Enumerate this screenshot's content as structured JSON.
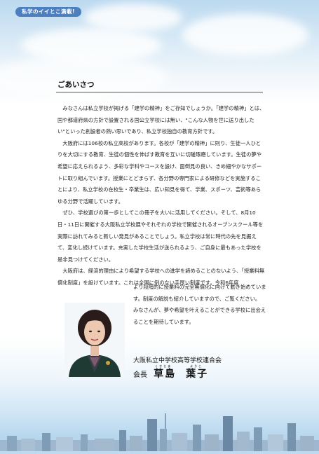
{
  "header": {
    "tag": "私学のイイとこ満載!"
  },
  "section": {
    "title": "ごあいさつ"
  },
  "paragraphs": [
    "みなさんは私立学校が掲げる「建学の精神」をご存知でしょうか。「建学の精神」とは、国や都道府県の方針で設置される国公立学校には無い、\"こんな人物を世に送り出したい\"といった創設者の熱い思いであり、私立学校独自の教育方針です。",
    "大阪府には106校の私立高校があります。各校が「建学の精神」に則り、生徒一人ひとりを大切にする教育、生徒の個性を伸ばす教育を互いに切磋琢磨しています。生徒の夢や希望に応えられるよう、多彩な学科やコースを設け、面倒見の良い、きめ細やかなサポートに取り組んでいます。授業にとどまらず、各分野の専門家による研修などを実施することにより、私立学校の在校生・卒業生は、広い知見を得て、学業、スポーツ、芸術等あらゆる分野で活躍しています。",
    "ぜひ、学校選びの第一歩としてこの冊子を大いに活用してください。そして、8月10日・11日に開催する大阪私立学校展やそれぞれの学校で開催されるオープンスクール等を実際に訪れてみると新しい発見があることでしょう。私立学校は常に時代の先を見据えて、変化し続けています。充実した学校生活が送られるよう、ご自身に最もあった学校を是非見つけてください。",
    "大阪府は、経済的理由により希望する学校への進学を諦めることのないよう、「授業料無償化制度」を設けています。これは全国に例のない手厚い制度です。令和6年度"
  ],
  "side_paragraphs": [
    "より段階的に授業料の完全無償化に向けて動き始めています。制度の解説も紹介していますので、ご覧ください。",
    "みなさんが、夢や希望を叶えることができる学校に出会えることを期待しています。"
  ],
  "signature": {
    "organization": "大阪私立中学校高等学校連合会",
    "role": "会長",
    "surname": "草島",
    "given_name": "葉子",
    "surname_ruby": "くさじま",
    "given_name_ruby": "ようこ"
  },
  "colors": {
    "accent": "#4d7fbf",
    "sky": "#bcd9ef"
  },
  "icons": {
    "photo": "portrait-photo",
    "skyline": "city-skyline-illustration"
  }
}
